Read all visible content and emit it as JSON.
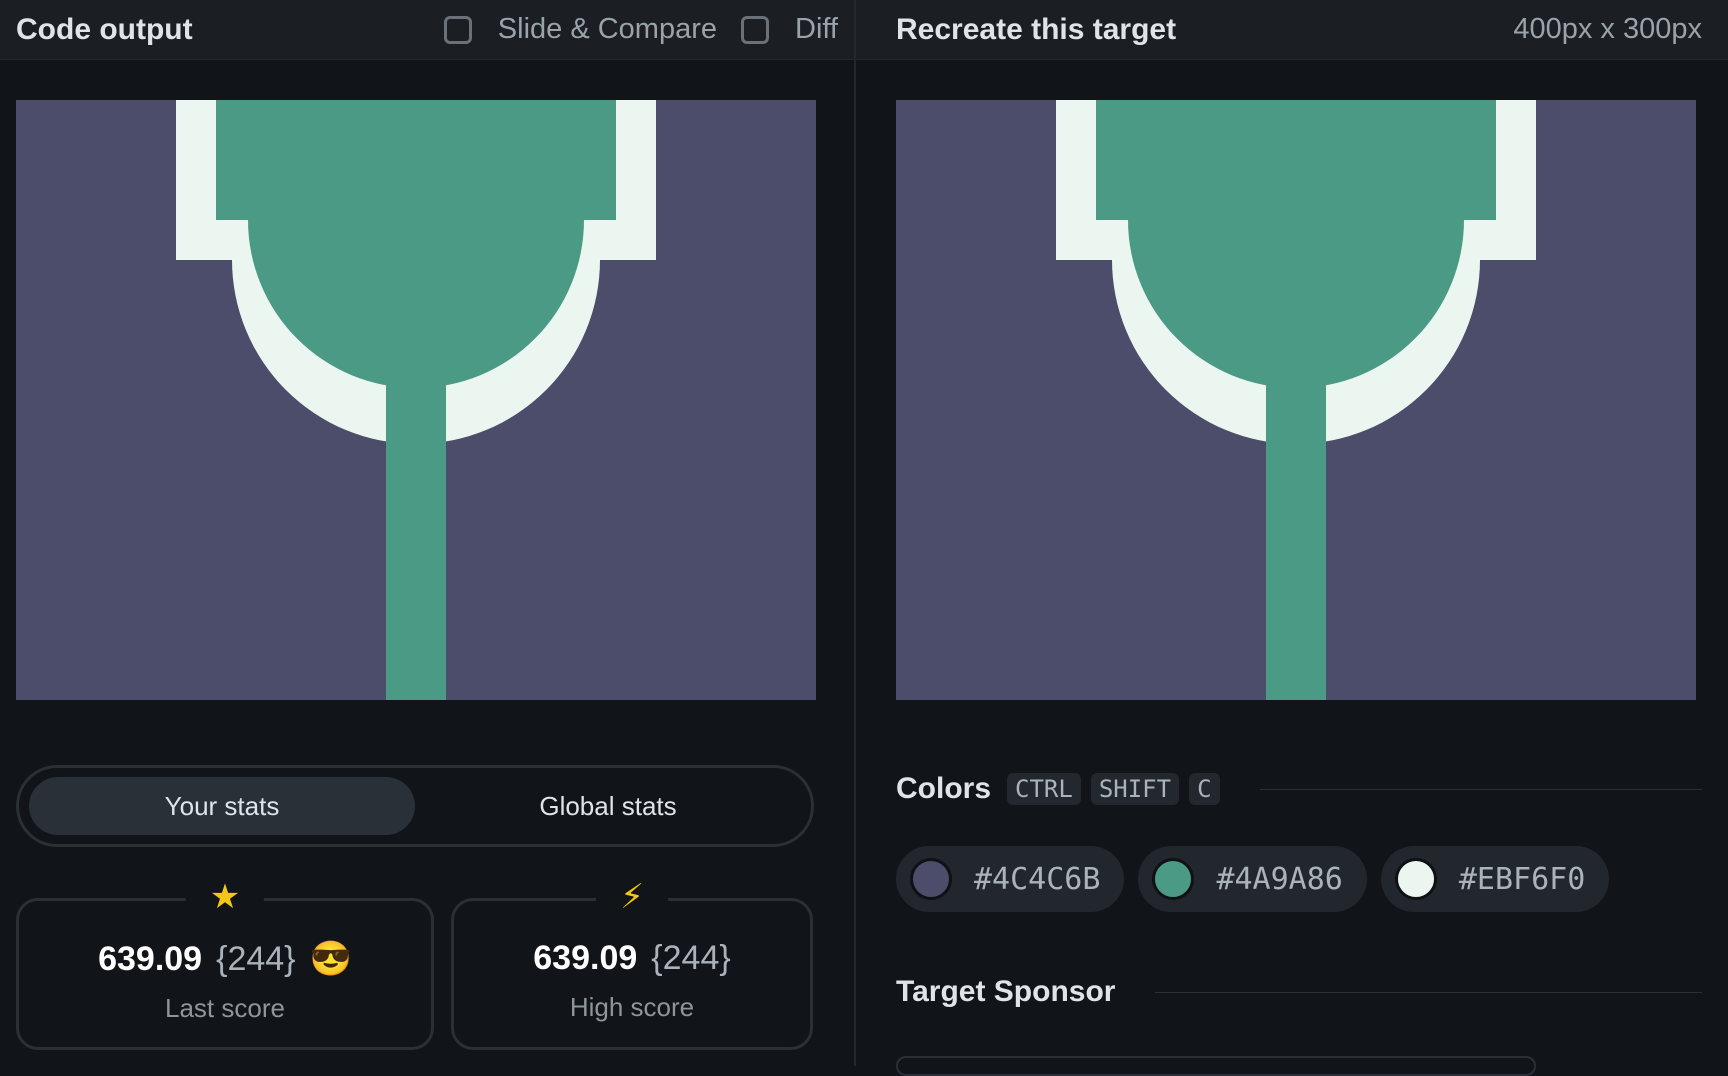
{
  "left_panel": {
    "title": "Code output",
    "options": [
      {
        "label": "Slide & Compare",
        "checked": false
      },
      {
        "label": "Diff",
        "checked": false
      }
    ]
  },
  "right_panel": {
    "title": "Recreate this target",
    "dimensions": "400px x 300px"
  },
  "stats": {
    "tabs": [
      {
        "label": "Your stats",
        "active": true
      },
      {
        "label": "Global stats",
        "active": false
      }
    ],
    "last_score": {
      "icon": "★",
      "score": "639.09",
      "count": "{244}",
      "emoji": "😎",
      "label": "Last score"
    },
    "high_score": {
      "icon": "⚡",
      "score": "639.09",
      "count": "{244}",
      "label": "High score"
    }
  },
  "colors": {
    "title": "Colors",
    "shortcut": [
      "CTRL",
      "SHIFT",
      "C"
    ],
    "swatches": [
      {
        "hex": "#4C4C6B"
      },
      {
        "hex": "#4A9A86"
      },
      {
        "hex": "#EBF6F0"
      }
    ]
  },
  "sponsor": {
    "title": "Target Sponsor"
  },
  "palette": {
    "background": "#4C4C6B",
    "green": "#4A9A86",
    "light": "#EBF6F0",
    "app_bg": "#111418"
  }
}
